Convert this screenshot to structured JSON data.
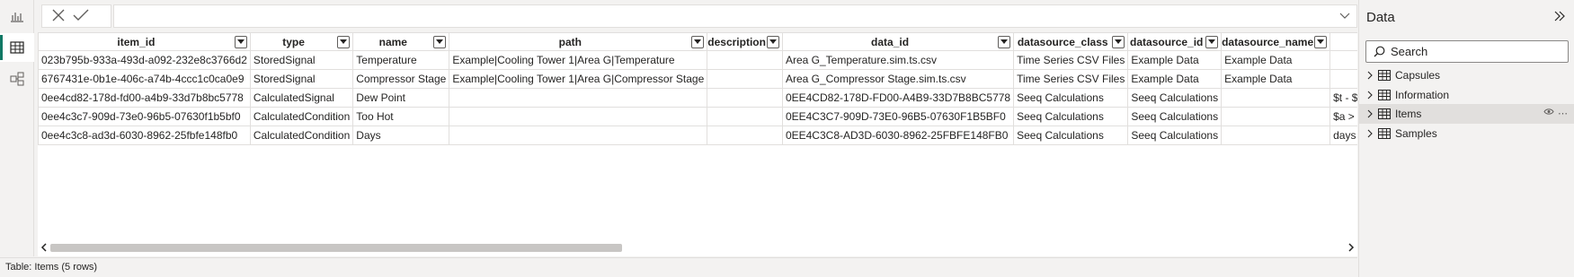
{
  "formula_bar": {
    "value": ""
  },
  "table": {
    "columns": [
      {
        "label": "item_id"
      },
      {
        "label": "type"
      },
      {
        "label": "name"
      },
      {
        "label": "path"
      },
      {
        "label": "description"
      },
      {
        "label": "data_id"
      },
      {
        "label": "datasource_class"
      },
      {
        "label": "datasource_id"
      },
      {
        "label": "datasource_name"
      },
      {
        "label": ""
      }
    ],
    "rows": [
      [
        "023b795b-933a-493d-a092-232e8c3766d2",
        "StoredSignal",
        "Temperature",
        "Example|Cooling Tower 1|Area G|Temperature",
        "",
        "Area G_Temperature.sim.ts.csv",
        "Time Series CSV Files",
        "Example Data",
        "Example Data",
        ""
      ],
      [
        "6767431e-0b1e-406c-a74b-4ccc1c0ca0e9",
        "StoredSignal",
        "Compressor Stage",
        "Example|Cooling Tower 1|Area G|Compressor Stage",
        "",
        "Area G_Compressor Stage.sim.ts.csv",
        "Time Series CSV Files",
        "Example Data",
        "Example Data",
        ""
      ],
      [
        "0ee4cd82-178d-fd00-a4b9-33d7b8bc5778",
        "CalculatedSignal",
        "Dew Point",
        "",
        "",
        "0EE4CD82-178D-FD00-A4B9-33D7B8BC5778",
        "Seeq Calculations",
        "Seeq Calculations",
        "",
        "$t - $"
      ],
      [
        "0ee4c3c7-909d-73e0-96b5-07630f1b5bf0",
        "CalculatedCondition",
        "Too Hot",
        "",
        "",
        "0EE4C3C7-909D-73E0-96B5-07630F1B5BF0",
        "Seeq Calculations",
        "Seeq Calculations",
        "",
        "$a >"
      ],
      [
        "0ee4c3c8-ad3d-6030-8962-25fbfe148fb0",
        "CalculatedCondition",
        "Days",
        "",
        "",
        "0EE4C3C8-AD3D-6030-8962-25FBFE148FB0",
        "Seeq Calculations",
        "Seeq Calculations",
        "",
        "days"
      ]
    ]
  },
  "status": {
    "text": "Table: Items (5 rows)"
  },
  "data_pane": {
    "title": "Data",
    "search_placeholder": "Search",
    "items": [
      {
        "label": "Capsules"
      },
      {
        "label": "Information"
      },
      {
        "label": "Items"
      },
      {
        "label": "Samples"
      }
    ]
  },
  "colors": {
    "accent": "#117865",
    "selected_row": "#e1dfdd"
  }
}
